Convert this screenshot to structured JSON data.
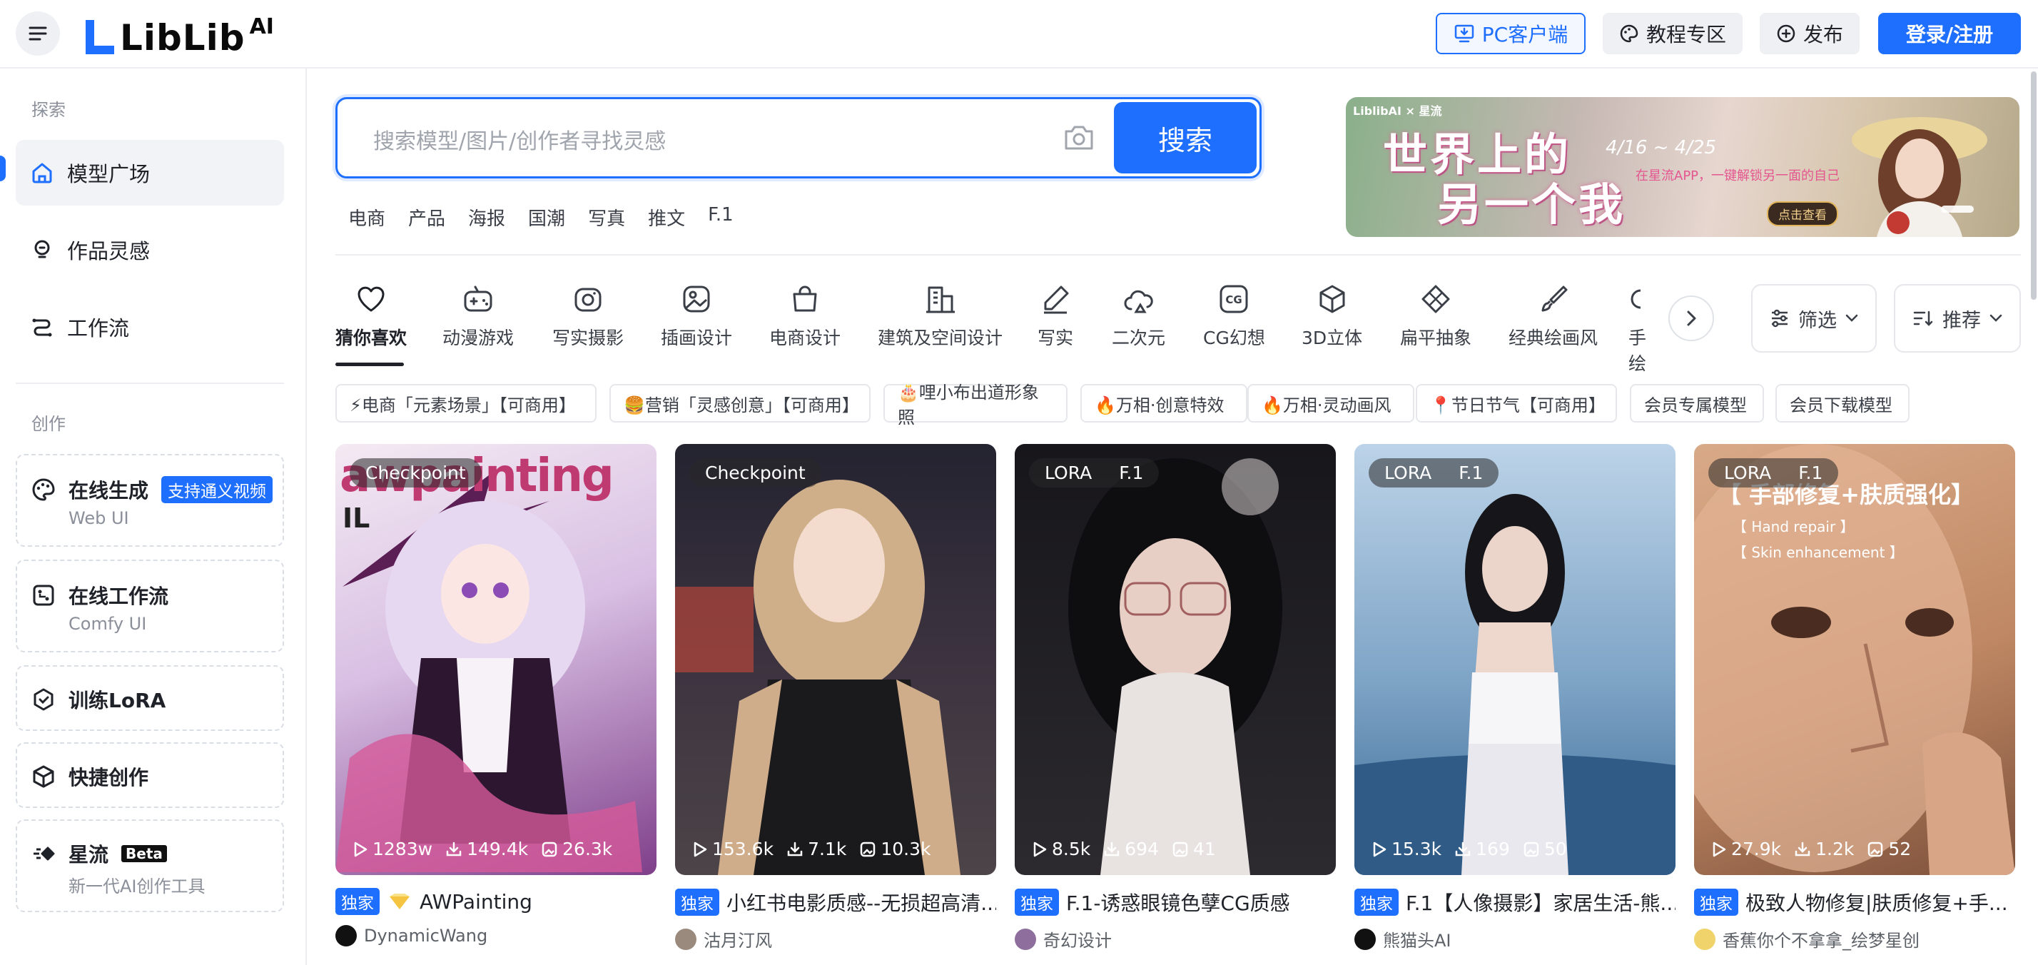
{
  "header": {
    "logo_text": "LibLib",
    "logo_sup": "AI",
    "pc_client": "PC客户端",
    "tutorial": "教程专区",
    "publish": "发布",
    "login": "登录/注册"
  },
  "sidebar": {
    "explore_label": "探索",
    "explore_items": [
      {
        "label": "模型广场",
        "icon": "home-icon",
        "active": true
      },
      {
        "label": "作品灵感",
        "icon": "lightbulb-icon"
      },
      {
        "label": "工作流",
        "icon": "workflow-icon"
      }
    ],
    "create_label": "创作",
    "tools": [
      {
        "label": "在线生成",
        "badge": "支持通义视频",
        "sub": "Web UI",
        "icon": "palette-icon"
      },
      {
        "label": "在线工作流",
        "sub": "Comfy UI",
        "icon": "nodes-icon"
      },
      {
        "label": "训练LoRA",
        "icon": "cube-train-icon"
      },
      {
        "label": "快捷创作",
        "icon": "box-icon"
      },
      {
        "label": "星流",
        "badge": "Beta",
        "sub": "新一代AI创作工具",
        "icon": "star-flow-icon"
      }
    ]
  },
  "search": {
    "placeholder": "搜索模型/图片/创作者寻找灵感",
    "button": "搜索",
    "hot_tags": [
      "电商",
      "产品",
      "海报",
      "国潮",
      "写真",
      "推文",
      "F.1"
    ]
  },
  "banner": {
    "brand": "LiblibAI × 星流",
    "title_line1": "世界上的",
    "title_line2": "另一个我",
    "date": "4/16 ~ 4/25",
    "subtitle": "在星流APP，一键解锁另一面的自己",
    "cta": "点击查看"
  },
  "categories": [
    {
      "label": "猜你喜欢",
      "icon": "heart-icon",
      "active": true
    },
    {
      "label": "动漫游戏",
      "icon": "gamepad-icon"
    },
    {
      "label": "写实摄影",
      "icon": "camera-icon"
    },
    {
      "label": "插画设计",
      "icon": "image-icon"
    },
    {
      "label": "电商设计",
      "icon": "shopping-bag-icon"
    },
    {
      "label": "建筑及空间设计",
      "icon": "building-icon"
    },
    {
      "label": "写实",
      "icon": "pen-icon"
    },
    {
      "label": "二次元",
      "icon": "cloud-icon"
    },
    {
      "label": "CG幻想",
      "icon": "cg-icon"
    },
    {
      "label": "3D立体",
      "icon": "cube-icon"
    },
    {
      "label": "扁平抽象",
      "icon": "diamond-icon"
    },
    {
      "label": "经典绘画风",
      "icon": "brush-icon"
    },
    {
      "label": "手绘",
      "icon": "hand-icon"
    }
  ],
  "filter": {
    "label": "筛选"
  },
  "sort": {
    "label": "推荐"
  },
  "chips": [
    "⚡电商「元素场景」【可商用】",
    "🍔营销「灵感创意」【可商用】",
    "🎂哩小布出道形象照",
    "🔥万相·创意特效",
    "🔥万相·灵动画风",
    "📍节日节气【可商用】",
    "会员专属模型",
    "会员下载模型"
  ],
  "cards": [
    {
      "tags": [
        "Checkpoint"
      ],
      "runs": "1283w",
      "downloads": "149.4k",
      "images": "26.3k",
      "exclusive": "独家",
      "title": "AWPainting",
      "author": "DynamicWang",
      "overlay": "awpainting",
      "overlay_sub": "IL",
      "colors": [
        "#f3e9f4",
        "#c49fd6",
        "#6a2d6e"
      ]
    },
    {
      "tags": [
        "Checkpoint"
      ],
      "runs": "153.6k",
      "downloads": "7.1k",
      "images": "10.3k",
      "exclusive": "独家",
      "title": "小红书电影质感--无损超高清...",
      "author": "沽月汀风",
      "colors": [
        "#2b2a33",
        "#6a5a54",
        "#d9b99a"
      ]
    },
    {
      "tags": [
        "LORA",
        "F.1"
      ],
      "runs": "8.5k",
      "downloads": "694",
      "images": "41",
      "exclusive": "独家",
      "title": "F.1-诱惑眼镜色孽CG质感",
      "author": "奇幻设计",
      "colors": [
        "#111114",
        "#3a3438",
        "#d9c2b9"
      ]
    },
    {
      "tags": [
        "LORA",
        "F.1"
      ],
      "runs": "15.3k",
      "downloads": "169",
      "images": "50",
      "exclusive": "独家",
      "title": "F.1【人像摄影】家居生活-熊...",
      "author": "熊猫头AI",
      "colors": [
        "#a9c3db",
        "#5d87ad",
        "#2d4f72"
      ]
    },
    {
      "tags": [
        "LORA",
        "F.1"
      ],
      "runs": "27.9k",
      "downloads": "1.2k",
      "images": "52",
      "exclusive": "独家",
      "title": "极致人物修复|肤质修复+手...",
      "author": "香蕉你个不拿拿_绘梦星创",
      "overlay": "【 手部修复+肤质强化】",
      "overlay_lines": [
        "【 Hand repair 】",
        "【 Skin enhancement 】"
      ],
      "colors": [
        "#d3a17f",
        "#b47a58",
        "#6e4734"
      ]
    }
  ]
}
